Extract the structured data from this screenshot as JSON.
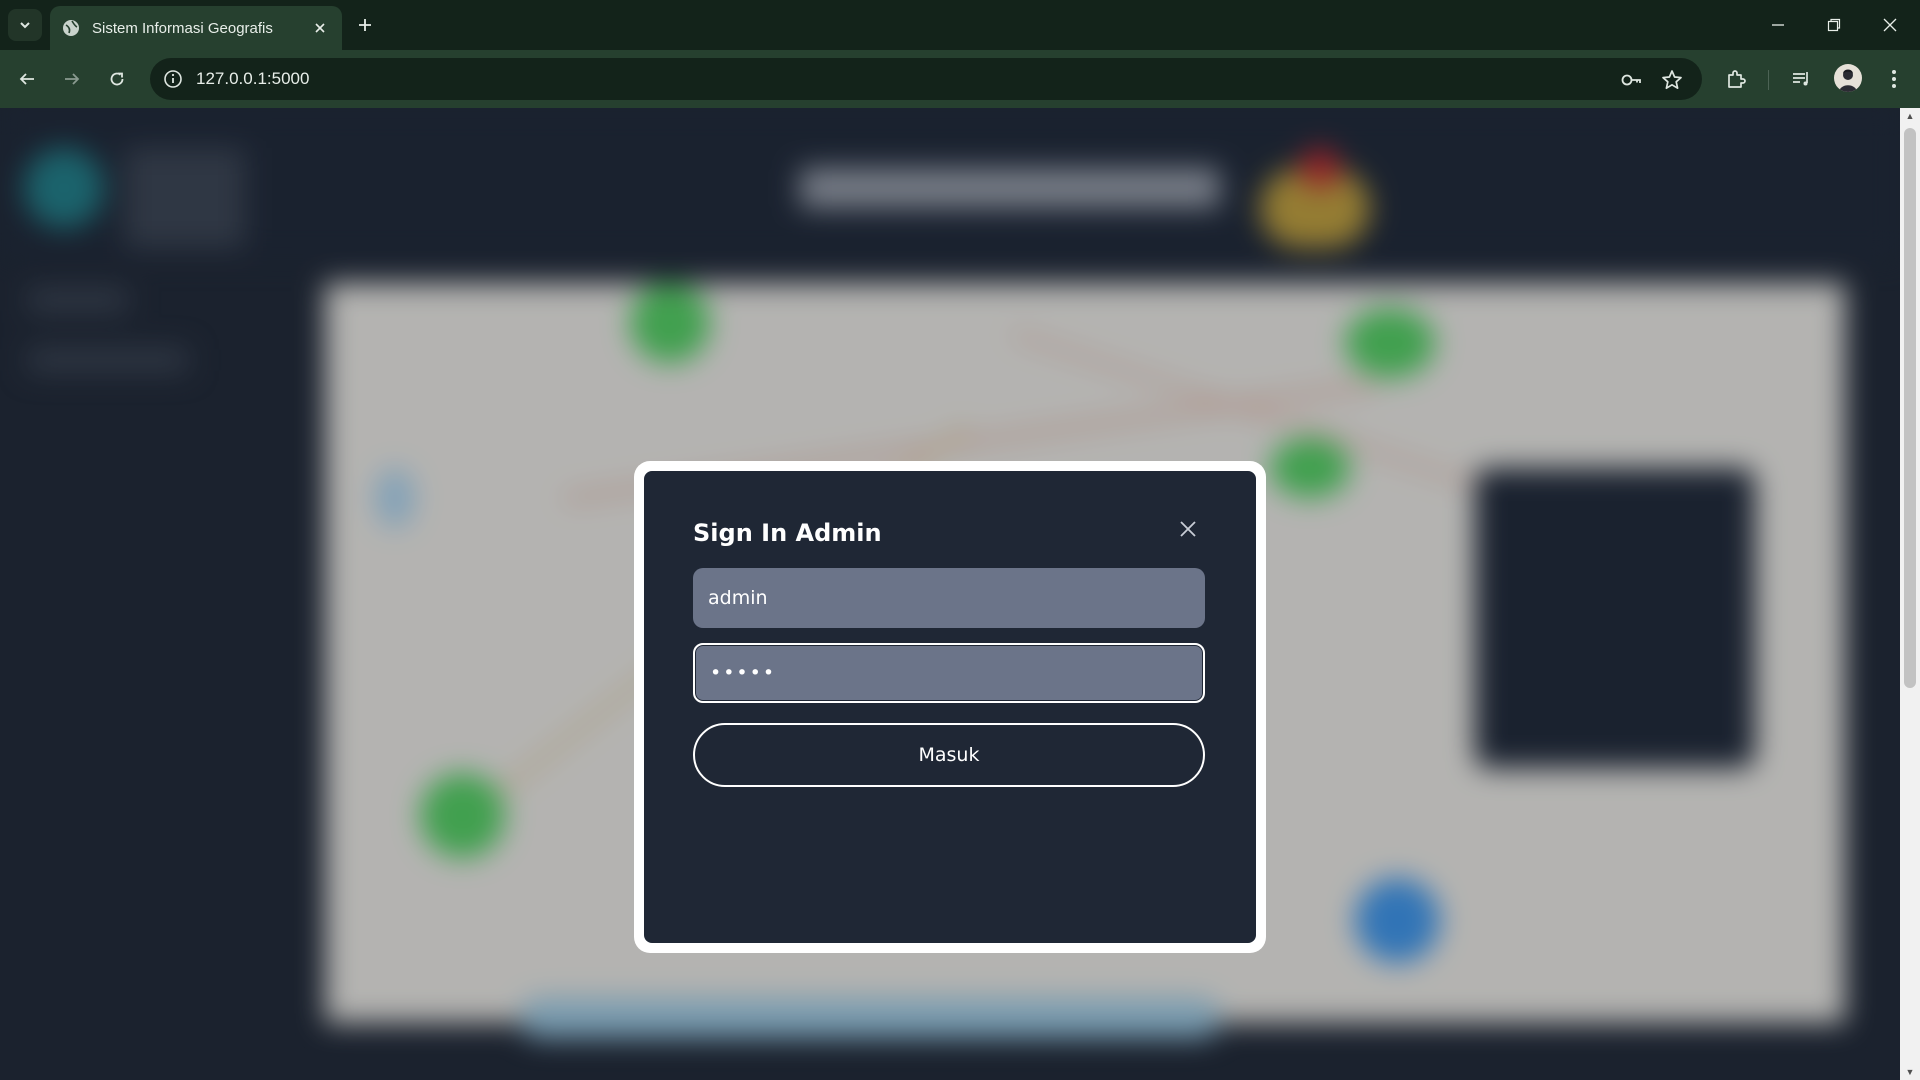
{
  "browser": {
    "tab_title": "Sistem Informasi Geografis",
    "url": "127.0.0.1:5000",
    "icons": [
      "tab-search-icon",
      "globe-icon",
      "close-icon",
      "plus-icon",
      "minimize-icon",
      "restore-icon",
      "back-arrow-icon",
      "forward-arrow-icon",
      "reload-icon",
      "site-info-icon",
      "password-key-icon",
      "bookmark-star-icon",
      "extensions-icon",
      "media-control-icon",
      "profile-avatar",
      "kebab-menu-icon"
    ]
  },
  "modal": {
    "title": "Sign In Admin",
    "username_value": "admin",
    "password_value": "•••••",
    "submit_label": "Masuk"
  },
  "colors": {
    "modal_bg": "#1f2735",
    "field_bg": "#6b7489",
    "page_bg": "#1f2733",
    "browser_frame": "#26402f"
  }
}
